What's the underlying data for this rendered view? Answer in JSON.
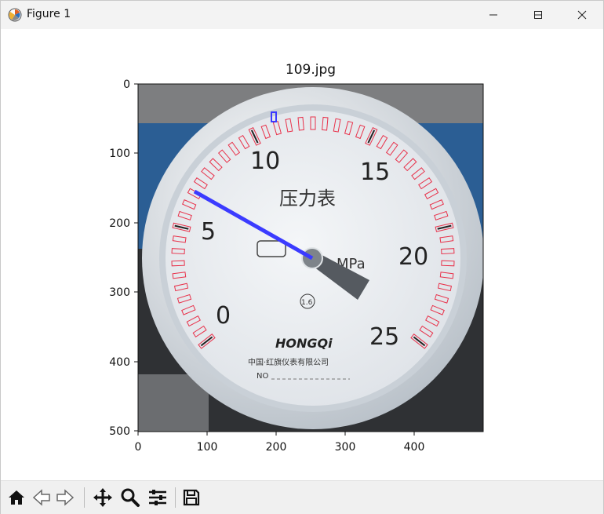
{
  "window": {
    "title": "Figure 1",
    "controls": {
      "minimize": "minimize",
      "maximize": "maximize",
      "close": "close"
    }
  },
  "plot": {
    "title": "109.jpg",
    "x_ticks": [
      "0",
      "100",
      "200",
      "300",
      "400"
    ],
    "y_ticks": [
      "0",
      "100",
      "200",
      "300",
      "400",
      "500"
    ],
    "xlim": [
      0,
      500
    ],
    "ylim": [
      500,
      0
    ]
  },
  "gauge": {
    "brand": "HONGQi",
    "unit": "MPa",
    "name_cn": "压力表",
    "maker_cn": "中国·红旗仪表有限公司",
    "class_mark": "1.6",
    "serial_prefix": "NO",
    "dial_numbers": [
      "0",
      "5",
      "10",
      "15",
      "20",
      "25"
    ]
  },
  "toolbar": {
    "buttons": [
      {
        "icon": "home-icon"
      },
      {
        "icon": "back-arrow-icon"
      },
      {
        "icon": "forward-arrow-icon"
      },
      {
        "icon": "pan-move-icon"
      },
      {
        "icon": "zoom-magnifier-icon"
      },
      {
        "icon": "configure-subplots-icon"
      },
      {
        "icon": "save-disk-icon"
      }
    ]
  },
  "colors": {
    "detection_box": "#e8314a",
    "detected_needle": "#3b3bff",
    "dial_face": "#eef0f3",
    "background_blue": "#2b5e94"
  }
}
